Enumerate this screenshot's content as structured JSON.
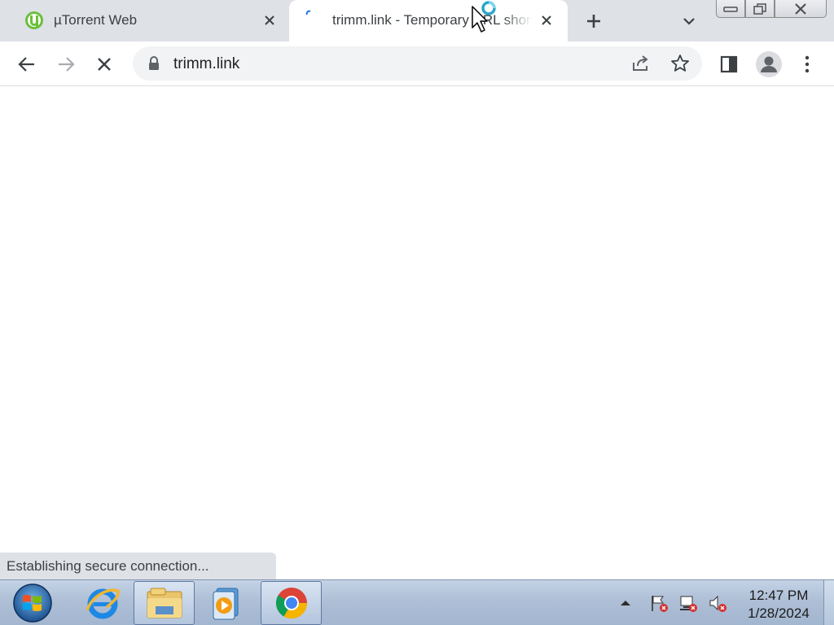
{
  "tabs": [
    {
      "title": "µTorrent Web",
      "active": false,
      "favicon": "utorrent-icon"
    },
    {
      "title": "trimm.link - Temporary URL shortener",
      "active": true,
      "favicon": "loading-spinner-icon"
    }
  ],
  "toolbar": {
    "url": "trimm.link",
    "icons": [
      "back-arrow-icon",
      "forward-arrow-icon",
      "stop-loading-icon",
      "lock-icon",
      "share-icon",
      "star-icon",
      "side-panel-icon",
      "profile-avatar-icon",
      "more-menu-icon"
    ]
  },
  "status": {
    "text": "Establishing secure connection..."
  },
  "taskbar": {
    "apps": [
      "start-orb-icon",
      "internet-explorer-icon",
      "file-explorer-icon",
      "media-player-icon",
      "chrome-icon"
    ],
    "tray_icons": [
      "show-hidden-icons-arrow",
      "action-center-flag-icon",
      "network-icon",
      "volume-muted-icon"
    ],
    "time": "12:47 PM",
    "date": "1/28/2024"
  },
  "colors": {
    "tabstrip": "#dee1e6",
    "omnibox": "#f1f3f4",
    "taskbar": "#aebfd6",
    "chrome_red": "#db4437",
    "chrome_green": "#0f9d58",
    "chrome_yellow": "#f4b400",
    "chrome_blue": "#4285f4"
  }
}
